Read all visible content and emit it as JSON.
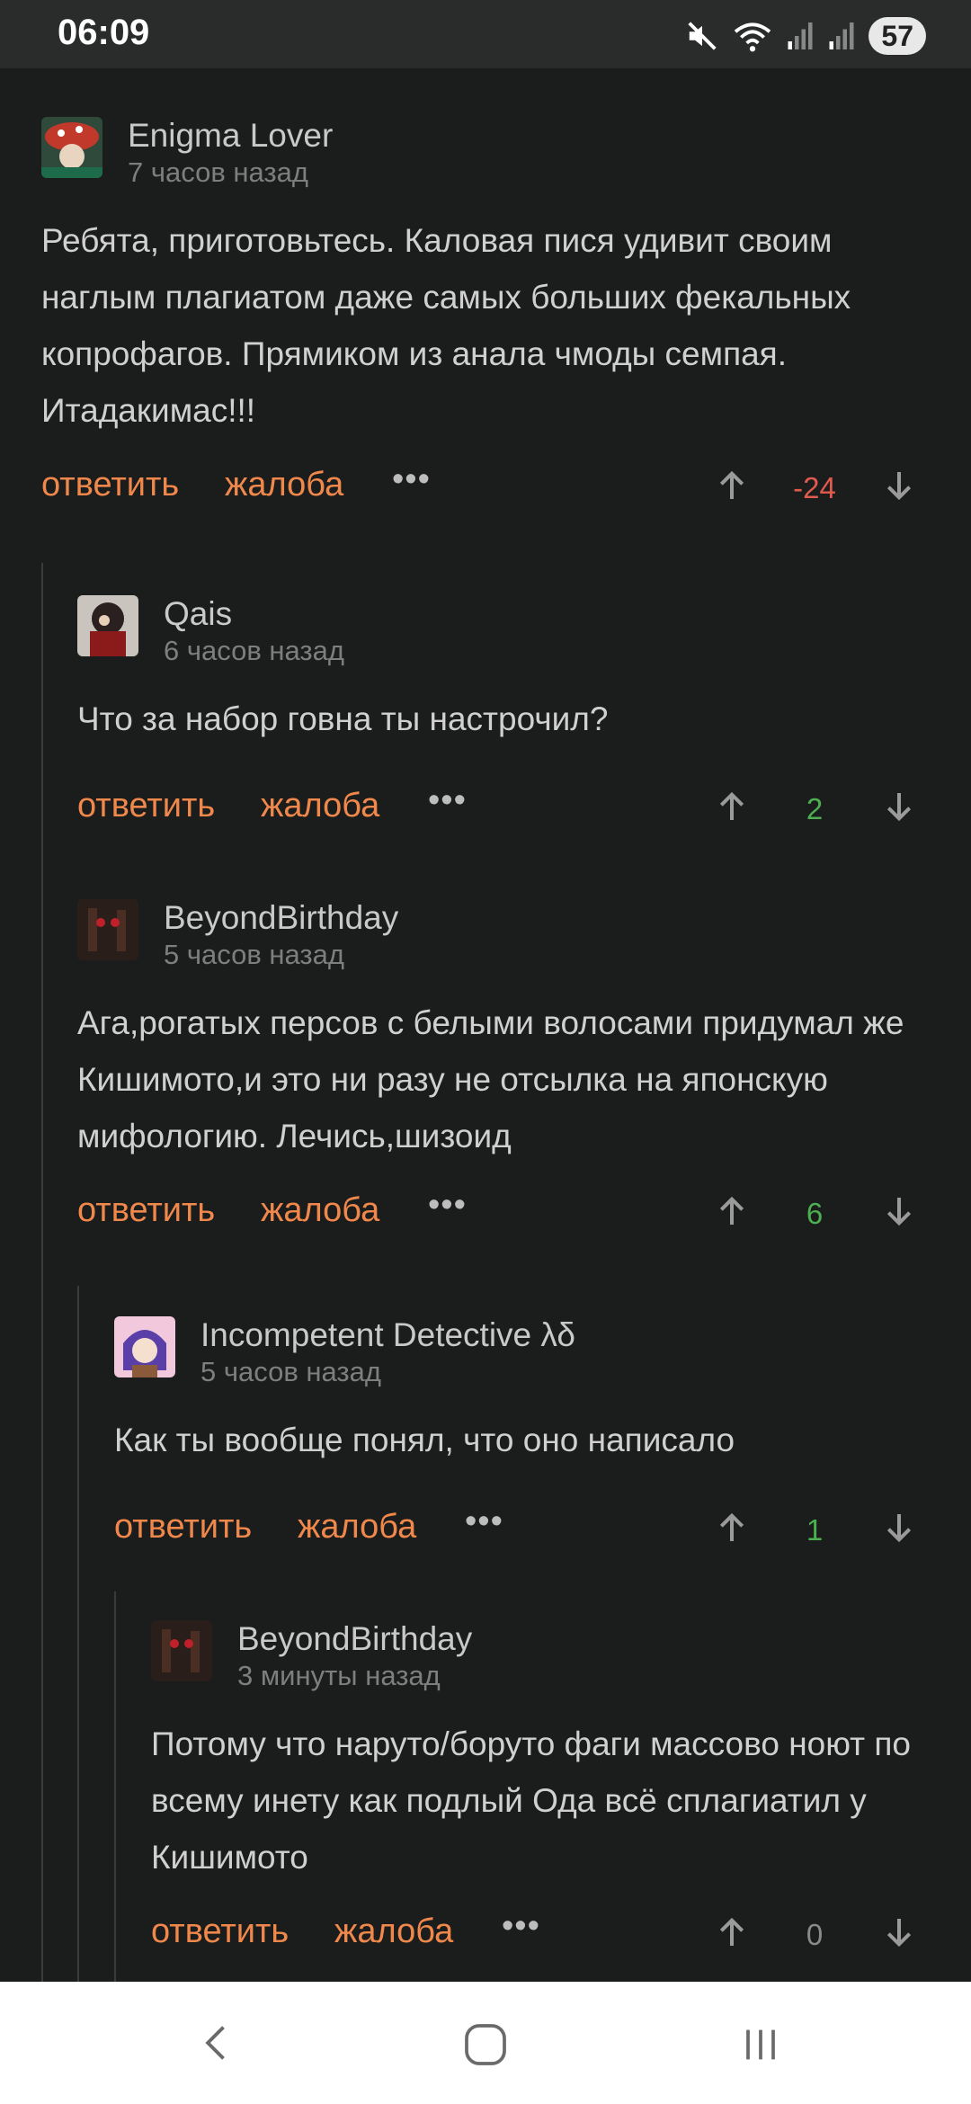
{
  "status_bar": {
    "time": "06:09",
    "battery": "57",
    "icons": [
      "mute-icon",
      "wifi-icon",
      "signal-icon",
      "signal-icon-2"
    ]
  },
  "colors": {
    "background": "#1b1d1c",
    "action_orange": "#f0884c",
    "negative_score": "#e05a4e",
    "positive_score": "#4caf50",
    "neutral_score": "#8a8a8a"
  },
  "actions": {
    "reply": "ответить",
    "report": "жалоба",
    "more": "•••"
  },
  "comments": [
    {
      "username": "Enigma Lover",
      "time": "7 часов назад",
      "text": "Ребята, приготовьтесь. Каловая пися удивит своим наглым плагиатом даже самых больших фекальных копрофагов. Прямиком из анала чмоды семпая. Итадакимас!!!",
      "score": "-24",
      "score_sign": "negative"
    },
    {
      "username": "Qais",
      "time": "6 часов назад",
      "text": "Что за набор говна ты настрочил?",
      "score": "2",
      "score_sign": "positive"
    },
    {
      "username": "BeyondBirthday",
      "time": "5 часов назад",
      "text": "Ага,рогатых персов с белыми волосами придумал же Кишимото,и это ни разу не отсылка на японскую мифологию. Лечись,шизоид",
      "score": "6",
      "score_sign": "positive"
    },
    {
      "username": "Incompetent Detective λδ",
      "time": "5 часов назад",
      "text": "Как ты вообще понял, что оно написало",
      "score": "1",
      "score_sign": "positive"
    },
    {
      "username": "BeyondBirthday",
      "time": "3 минуты назад",
      "text": "Потому что наруто/боруто фаги массово ноют по всему инету как подлый Ода всё сплагиатил у Кишимото",
      "score": "0",
      "score_sign": "neutral"
    }
  ],
  "nav_bar": {
    "icons": [
      "back-icon",
      "home-icon",
      "recents-icon"
    ]
  }
}
